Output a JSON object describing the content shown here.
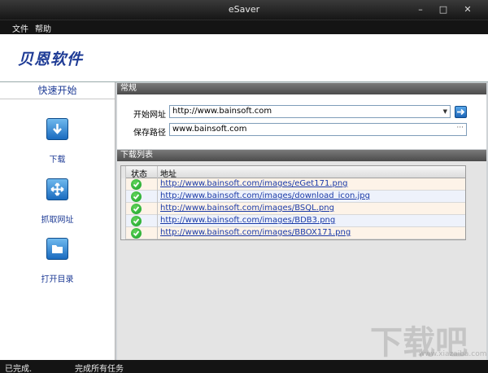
{
  "window": {
    "title": "eSaver",
    "min": "–",
    "max": "□",
    "close": "✕"
  },
  "menu": {
    "items": [
      "文件",
      "帮助"
    ]
  },
  "banner": {
    "brand": "贝恩软件"
  },
  "sidebar": {
    "heading": "快速开始",
    "buttons": [
      {
        "label": "下载",
        "icon": "download-icon"
      },
      {
        "label": "抓取网址",
        "icon": "crawl-icon"
      },
      {
        "label": "打开目录",
        "icon": "folder-icon"
      }
    ]
  },
  "general": {
    "heading": "常规",
    "start_url_label": "开始网址",
    "start_url": "http://www.bainsoft.com",
    "save_path_label": "保存路径",
    "save_path": "www.bainsoft.com",
    "browse": "···"
  },
  "downloads": {
    "heading": "下载列表",
    "columns": [
      "状态",
      "地址"
    ],
    "rows": [
      {
        "status": "done",
        "url": "http://www.bainsoft.com/images/eGet171.png"
      },
      {
        "status": "done",
        "url": "http://www.bainsoft.com/images/download_icon.jpg"
      },
      {
        "status": "done",
        "url": "http://www.bainsoft.com/images/BSQL.png"
      },
      {
        "status": "done",
        "url": "http://www.bainsoft.com/images/BDB3.png"
      },
      {
        "status": "done",
        "url": "http://www.bainsoft.com/images/BBOX171.png"
      }
    ]
  },
  "statusbar": {
    "left": "已完成.",
    "message": "完成所有任务"
  },
  "watermark": {
    "text": "下载吧",
    "sub": "www.xiazaiba.com"
  },
  "colors": {
    "accent": "#1f3c96",
    "link": "#1a3aa8",
    "ok": "#16a028"
  }
}
